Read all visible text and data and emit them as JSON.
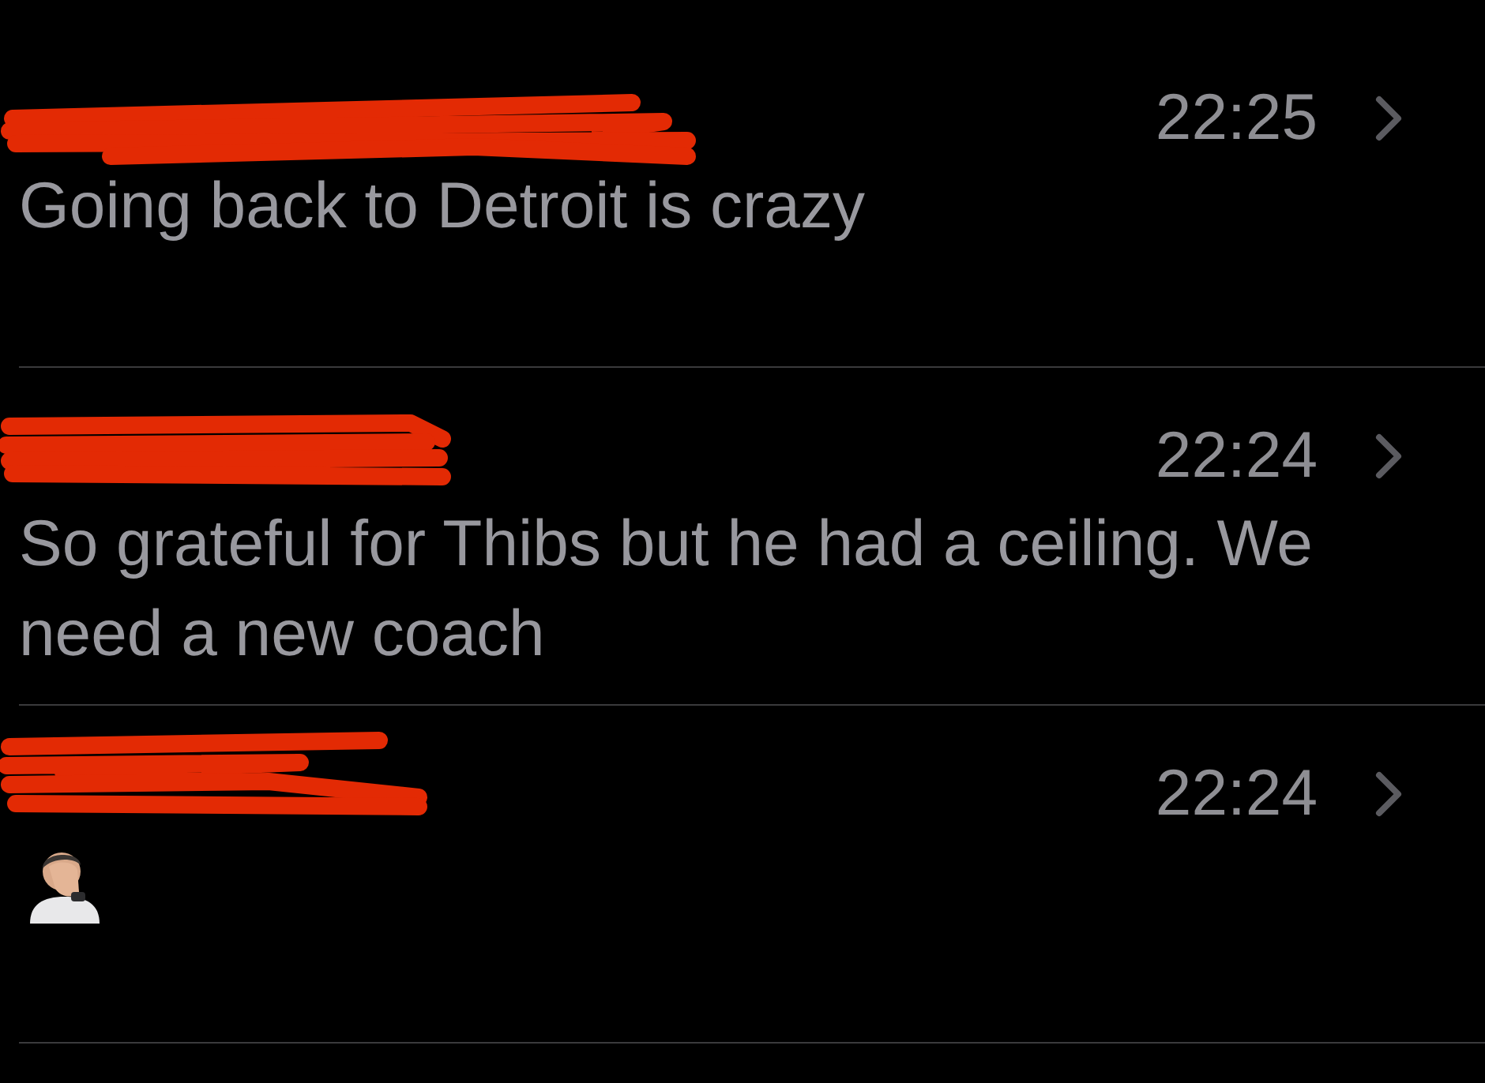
{
  "messages": [
    {
      "redacted": true,
      "time": "22:25",
      "body": {
        "kind": "text",
        "text": "Going back to Detroit is crazy"
      }
    },
    {
      "redacted": true,
      "time": "22:24",
      "body": {
        "kind": "text",
        "text": "So grateful for Thibs but he had a ceiling. We need a new coach"
      }
    },
    {
      "redacted": true,
      "time": "22:24",
      "body": {
        "kind": "sticker"
      }
    }
  ]
}
